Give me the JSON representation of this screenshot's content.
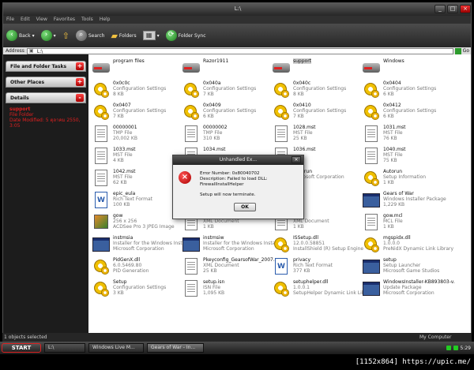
{
  "window": {
    "title": "L:\\"
  },
  "menu": [
    "File",
    "Edit",
    "View",
    "Favorites",
    "Tools",
    "Help"
  ],
  "toolbar": {
    "back": "Back",
    "search": "Search",
    "folders": "Folders",
    "folder_sync": "Folder Sync"
  },
  "address": {
    "label": "Address",
    "value": "L:\\",
    "go": "Go"
  },
  "left_pane": {
    "sections": [
      {
        "label": "File and Folder Tasks",
        "toggle": "+"
      },
      {
        "label": "Other Places",
        "toggle": "+"
      },
      {
        "label": "Details",
        "toggle": "-"
      }
    ],
    "details": {
      "name": "support",
      "type": "File Folder",
      "date": "Date Modified: 5 ตุลาคม 2550, 3:05"
    }
  },
  "items": [
    {
      "icon": "folder",
      "name": "program files",
      "type": "",
      "size": ""
    },
    {
      "icon": "folder",
      "name": "Razor1911",
      "type": "",
      "size": ""
    },
    {
      "icon": "folder",
      "name": "support",
      "type": "",
      "size": "",
      "selected": true
    },
    {
      "icon": "folder",
      "name": "Windows",
      "type": "",
      "size": ""
    },
    {
      "icon": "gear",
      "name": "0x0c0c",
      "type": "Configuration Settings",
      "size": "8 KB"
    },
    {
      "icon": "gear",
      "name": "0x040a",
      "type": "Configuration Settings",
      "size": "7 KB"
    },
    {
      "icon": "gear",
      "name": "0x040c",
      "type": "Configuration Settings",
      "size": "8 KB"
    },
    {
      "icon": "gear",
      "name": "0x0404",
      "type": "Configuration Settings",
      "size": "6 KB"
    },
    {
      "icon": "gear",
      "name": "0x0407",
      "type": "Configuration Settings",
      "size": "7 KB"
    },
    {
      "icon": "gear",
      "name": "0x0409",
      "type": "Configuration Settings",
      "size": "6 KB"
    },
    {
      "icon": "gear",
      "name": "0x0410",
      "type": "Configuration Settings",
      "size": "7 KB"
    },
    {
      "icon": "gear",
      "name": "0x0412",
      "type": "Configuration Settings",
      "size": "6 KB"
    },
    {
      "icon": "doc",
      "name": "00000001",
      "type": "TMP File",
      "size": "20,002 KB"
    },
    {
      "icon": "doc",
      "name": "00000002",
      "type": "TMP File",
      "size": "310 KB"
    },
    {
      "icon": "doc",
      "name": "1028.mst",
      "type": "MST File",
      "size": "25 KB"
    },
    {
      "icon": "doc",
      "name": "1031.mst",
      "type": "MST File",
      "size": "76 KB"
    },
    {
      "icon": "doc",
      "name": "1033.mst",
      "type": "MST File",
      "size": "4 KB"
    },
    {
      "icon": "doc",
      "name": "1034.mst",
      "type": "",
      "size": ""
    },
    {
      "icon": "doc",
      "name": "1036.mst",
      "type": "",
      "size": ""
    },
    {
      "icon": "doc",
      "name": "1040.mst",
      "type": "MST File",
      "size": "75 KB"
    },
    {
      "icon": "doc",
      "name": "1042.mst",
      "type": "MST File",
      "size": "62 KB"
    },
    {
      "icon": "doc",
      "name": "",
      "type": "",
      "size": ""
    },
    {
      "icon": "gear",
      "name": "Autorun",
      "type": "Microsoft Corporation",
      "size": ""
    },
    {
      "icon": "gear",
      "name": "Autorun",
      "type": "Setup Information",
      "size": "1 KB"
    },
    {
      "icon": "word",
      "name": "epic_eula",
      "type": "Rich Text Format",
      "size": "100 KB"
    },
    {
      "icon": "doc",
      "name": "",
      "type": "",
      "size": ""
    },
    {
      "icon": "doc",
      "name": "",
      "type": "5.32",
      "size": ""
    },
    {
      "icon": "app",
      "name": "Gears of War",
      "type": "Windows Installer Package",
      "size": "1,229 KB"
    },
    {
      "icon": "img",
      "name": "gow",
      "type": "256 x 256",
      "size": "ACDSee Pro 3 JPEG Image"
    },
    {
      "icon": "doc",
      "name": "gow",
      "type": "XML Document",
      "size": "1 KB"
    },
    {
      "icon": "doc",
      "name": "gow",
      "type": "XML Document",
      "size": "1 KB"
    },
    {
      "icon": "doc",
      "name": "gow.mcl",
      "type": "MCL File",
      "size": "1 KB"
    },
    {
      "icon": "app",
      "name": "instmsia",
      "type": "Installer for the Windows Instal...",
      "size": "Microsoft Corporation"
    },
    {
      "icon": "app",
      "name": "instmsiw",
      "type": "Installer for the Windows Instal...",
      "size": "Microsoft Corporation"
    },
    {
      "icon": "gear",
      "name": "ISSetup.dll",
      "type": "12.0.0.58851",
      "size": "InstallShield (R) Setup Engine"
    },
    {
      "icon": "gear",
      "name": "mgspidx.dll",
      "type": "1.0.0.0",
      "size": "PreNidX Dynamic Link Library"
    },
    {
      "icon": "gear",
      "name": "PidGenX.dll",
      "type": "6.0.5469.80",
      "size": "PID Generation"
    },
    {
      "icon": "doc",
      "name": "Pkeyconfig_GearsofWar_2007...",
      "type": "XML Document",
      "size": "25 KB"
    },
    {
      "icon": "word",
      "name": "privacy",
      "type": "Rich Text Format",
      "size": "377 KB"
    },
    {
      "icon": "app",
      "name": "setup",
      "type": "Setup Launcher",
      "size": "Microsoft Game Studios"
    },
    {
      "icon": "gear",
      "name": "Setup",
      "type": "Configuration Settings",
      "size": "3 KB"
    },
    {
      "icon": "doc",
      "name": "setup.isn",
      "type": "ISN File",
      "size": "1,095 KB"
    },
    {
      "icon": "gear",
      "name": "setuphelper.dll",
      "type": "1.0.0.1",
      "size": "SetupHelper Dynamic Link Librar..."
    },
    {
      "icon": "app",
      "name": "WindowsInstaller-KB893803-v...",
      "type": "Update Package",
      "size": "Microsoft Corporation"
    }
  ],
  "dialog": {
    "title": "Unhandled Ex...",
    "line1": "Error Number: 0x80040702",
    "line2": "Description: Failed to load DLL: FirewallInstallHelper",
    "line3": "Setup will now terminate.",
    "ok": "OK"
  },
  "status": {
    "left": "1 objects selected",
    "right": "My Computer"
  },
  "taskbar": {
    "start": "START",
    "tasks": [
      "L:\\",
      "Windows Live M...",
      "Gears of War - In..."
    ],
    "clock": "5:29"
  },
  "watermark": "[1152x864] https://upic.me/"
}
